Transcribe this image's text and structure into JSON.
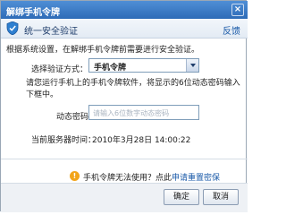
{
  "window": {
    "title": "解绑手机令牌",
    "close_symbol": "×"
  },
  "header": {
    "title": "统一安全验证",
    "feedback": "反馈"
  },
  "intro": "根据系统设置，在解绑手机令牌前需要进行安全验证。",
  "method": {
    "label": "选择验证方式：",
    "selected": "手机令牌"
  },
  "instruction": "请您运行手机上的手机令牌软件，将显示的6位动态密码输入下框中。",
  "code": {
    "label": "动态密码：",
    "placeholder": "请输入6位数字动态密码"
  },
  "server": {
    "label": "当前服务器时间：",
    "time": "2010年3月28日 14:00:22"
  },
  "help": {
    "icon_text": "!",
    "text": "手机令牌无法使用？点此",
    "link": "申请重置密保"
  },
  "buttons": {
    "ok": "确定",
    "cancel": "取消"
  },
  "colors": {
    "titlebar": "#2e6bb7",
    "link": "#1a5aa8",
    "help_icon": "#f2a51a"
  }
}
